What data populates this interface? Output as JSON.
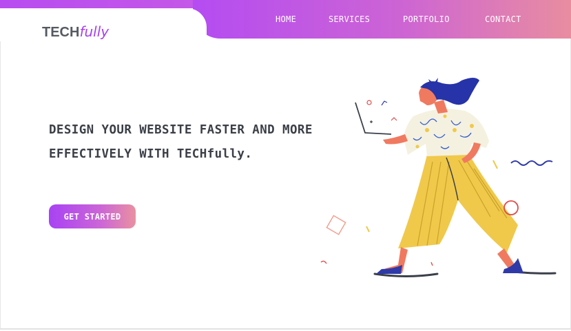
{
  "brand": {
    "logo_main": "TECH",
    "logo_accent": "fully"
  },
  "nav": {
    "items": [
      "HOME",
      "SERVICES",
      "PORTFOLIO",
      "CONTACT"
    ]
  },
  "hero": {
    "headline_line1": "DESIGN YOUR WEBSITE FASTER AND MORE",
    "headline_line2": "EFFECTIVELY WITH TECHfully.",
    "cta_label": "GET STARTED"
  },
  "colors": {
    "gradient_start": "#b44cf2",
    "gradient_end": "#e88da0",
    "headline": "#3b3f47",
    "logo_accent": "#a63ff0"
  },
  "illustration": {
    "icon": "woman-with-laptop-illustration"
  }
}
